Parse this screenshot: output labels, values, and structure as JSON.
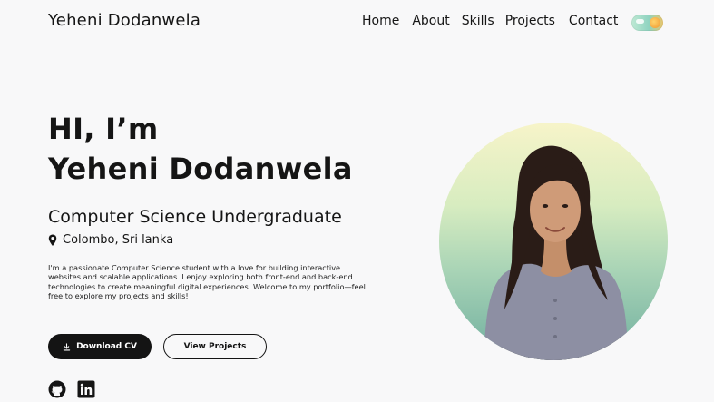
{
  "header": {
    "brand": "Yeheni Dodanwela",
    "nav": [
      "Home",
      "About",
      "Skills",
      "Projects",
      "Contact"
    ]
  },
  "hero": {
    "greeting": "HI, I’m",
    "name": "Yeheni Dodanwela",
    "subtitle": "Computer Science Undergraduate",
    "location": "Colombo, Sri lanka",
    "bio": "I'm a passionate Computer Science student with a love for building interactive websites and scalable applications. I enjoy exploring both front-end and back-end technologies to create meaningful digital experiences. Welcome to my portfolio—feel free to explore my projects and skills!",
    "buttons": {
      "cv": "Download CV",
      "projects": "View Projects"
    }
  },
  "icons": {
    "theme": "sun-icon",
    "location": "map-pin-icon",
    "download": "download-icon",
    "github": "github-icon",
    "linkedin": "linkedin-icon"
  },
  "colors": {
    "background": "#f8f8f9",
    "text": "#151515",
    "button_dark": "#141414",
    "photo_gradient_top": "#f7f4c9",
    "photo_gradient_bottom": "#6fae9f"
  }
}
